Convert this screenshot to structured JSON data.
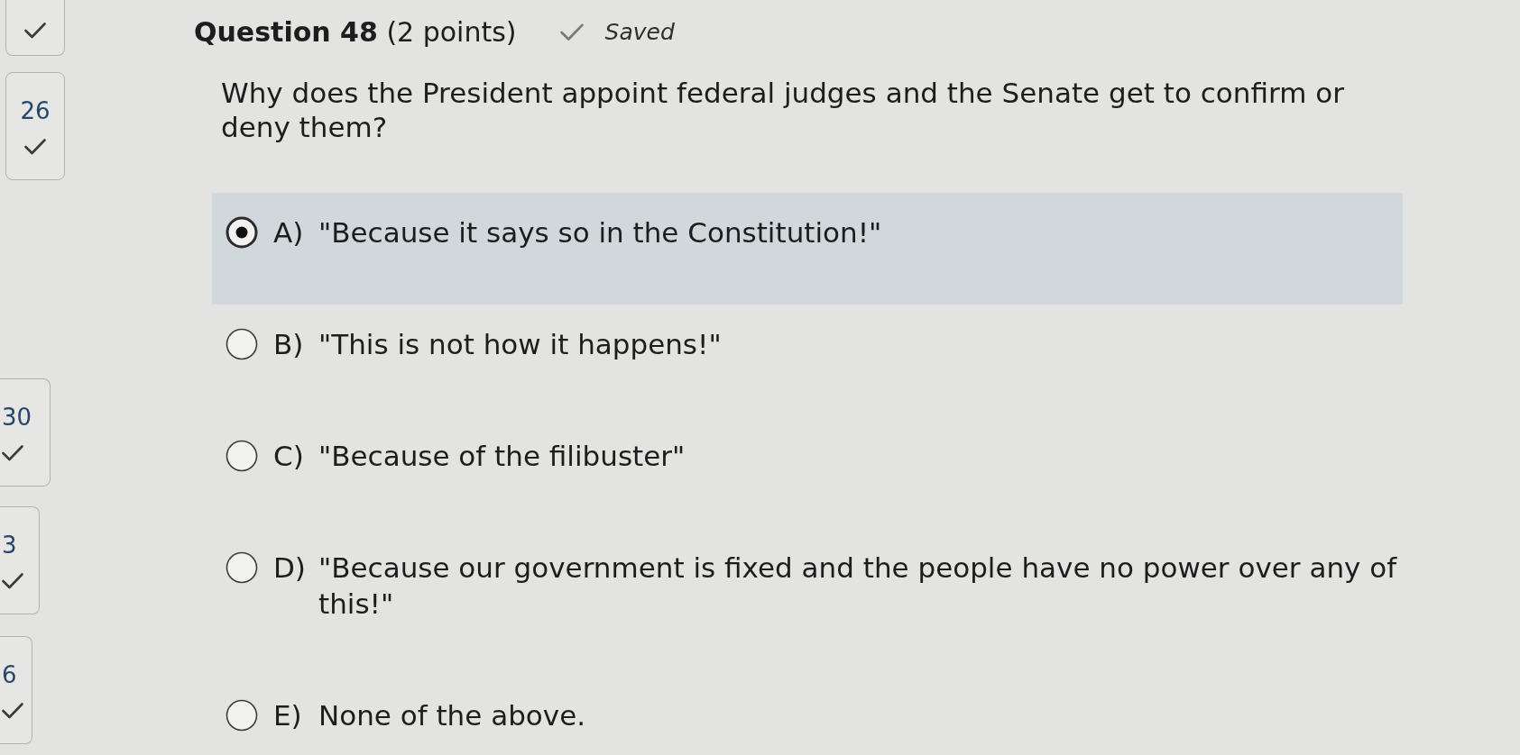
{
  "sidebar": {
    "items": [
      {
        "answered": true
      },
      {
        "number": "26",
        "answered": true
      },
      {
        "number": "30",
        "answered": true
      },
      {
        "number": "3",
        "answered": true
      },
      {
        "number": "6",
        "answered": true
      }
    ]
  },
  "question": {
    "title": "**Question 48** (2 points)",
    "status": "Saved",
    "prompt": "Why does the President appoint federal judges and the Senate get to confirm or deny them?"
  },
  "options": [
    {
      "letter": "A)",
      "text": "\"Because it says so in the Constitution!\"",
      "selected": true
    },
    {
      "letter": "B)",
      "text": "\"This is not how it happens!\"",
      "selected": false
    },
    {
      "letter": "C)",
      "text": "\"Because of the filibuster\"",
      "selected": false
    },
    {
      "letter": "D)",
      "text": "\"Because our government is fixed and the people have no power over any of this!\"",
      "selected": false
    },
    {
      "letter": "E)",
      "text": "None of the above.",
      "selected": false
    }
  ]
}
